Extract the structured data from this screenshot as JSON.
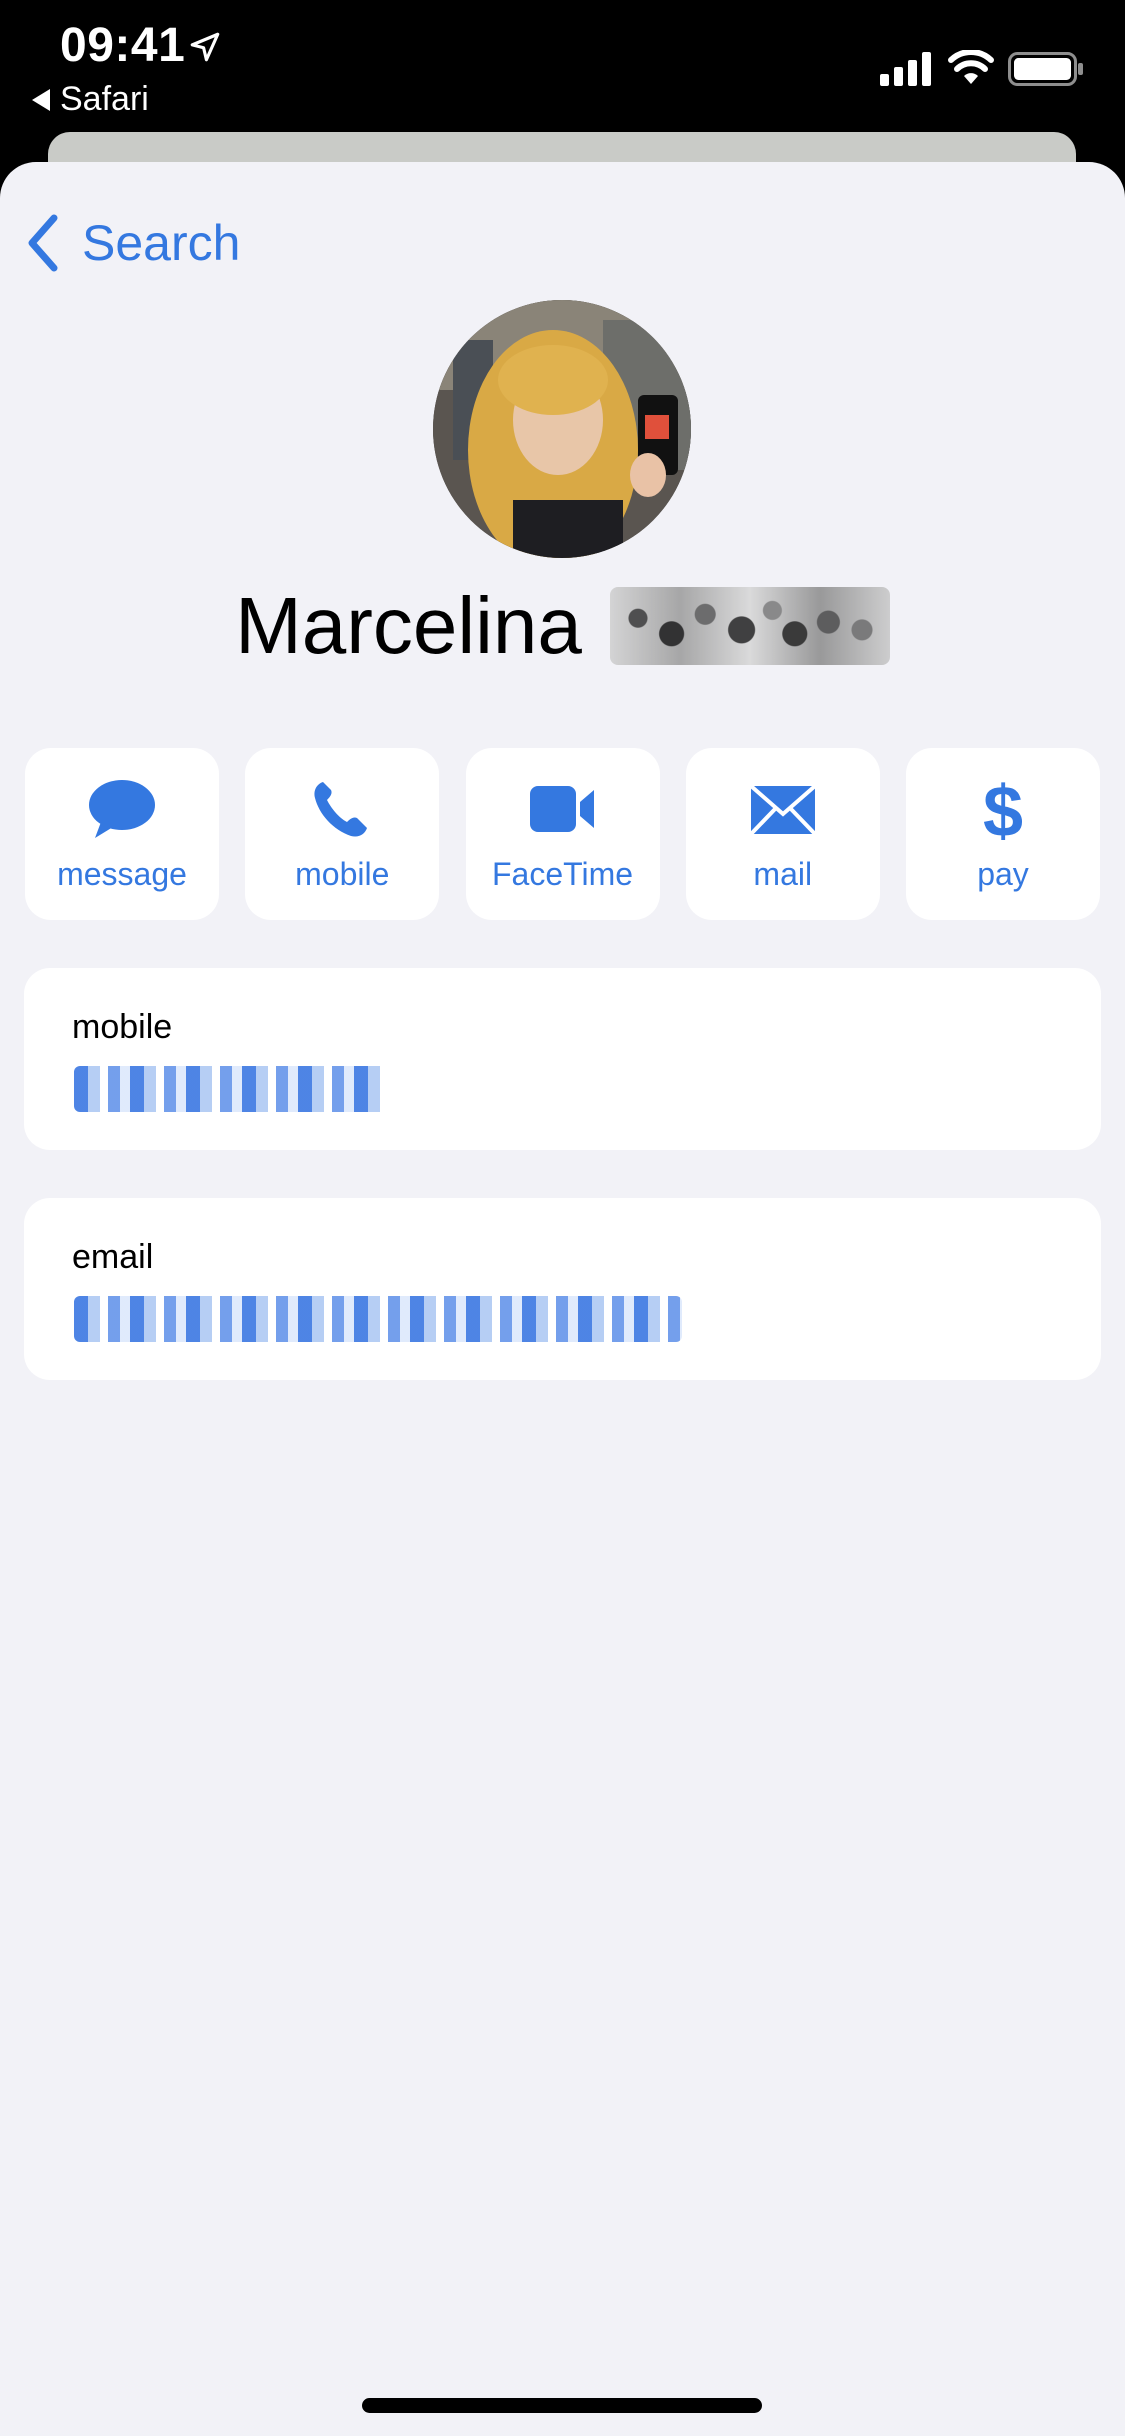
{
  "status_bar": {
    "time": "09:41",
    "back_app": "Safari",
    "icons": [
      "location-arrow-icon",
      "cellular-signal-icon",
      "wifi-icon",
      "battery-icon"
    ]
  },
  "nav": {
    "back_label": "Search",
    "back_icon": "chevron-left-icon"
  },
  "contact": {
    "first_name": "Marcelina",
    "last_name_redacted": true
  },
  "actions": [
    {
      "label": "message",
      "icon": "message-bubble-icon"
    },
    {
      "label": "mobile",
      "icon": "phone-icon"
    },
    {
      "label": "FaceTime",
      "icon": "video-camera-icon"
    },
    {
      "label": "mail",
      "icon": "envelope-icon"
    },
    {
      "label": "pay",
      "icon": "dollar-icon"
    }
  ],
  "fields": [
    {
      "label": "mobile",
      "value_redacted": true
    },
    {
      "label": "email",
      "value_redacted": true
    }
  ],
  "colors": {
    "accent": "#3478e0",
    "background": "#f2f2f7",
    "card": "#ffffff"
  }
}
